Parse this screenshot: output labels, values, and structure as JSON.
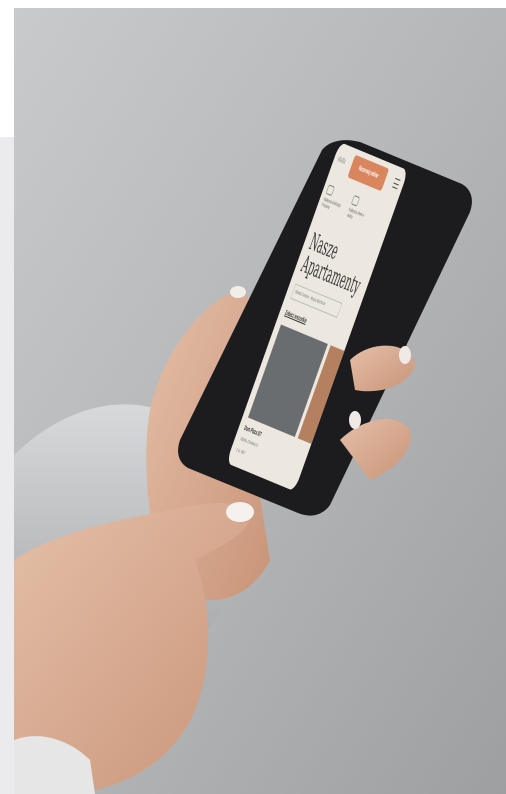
{
  "app": {
    "logo": "ıllıllı",
    "book_button": "Rezerwuj online"
  },
  "features": [
    {
      "label": "Najlepsza lokalizacja Poznania"
    },
    {
      "label": "Najlepsza oferta w okolicy"
    }
  ],
  "main": {
    "heading_line1": "Nasze",
    "heading_line2": "Apartamenty",
    "select_value": "Gdańsk Centrum – Wyspa Spichrzów",
    "see_all": "Zobacz wszystkie"
  },
  "card": {
    "title": "Dom Plaza 0/7",
    "subtitle": "Gdańsk, Chmielna 31",
    "meta": "2 os.   45m²"
  },
  "colors": {
    "accent": "#d9865f",
    "screen_bg": "#ece7df"
  }
}
